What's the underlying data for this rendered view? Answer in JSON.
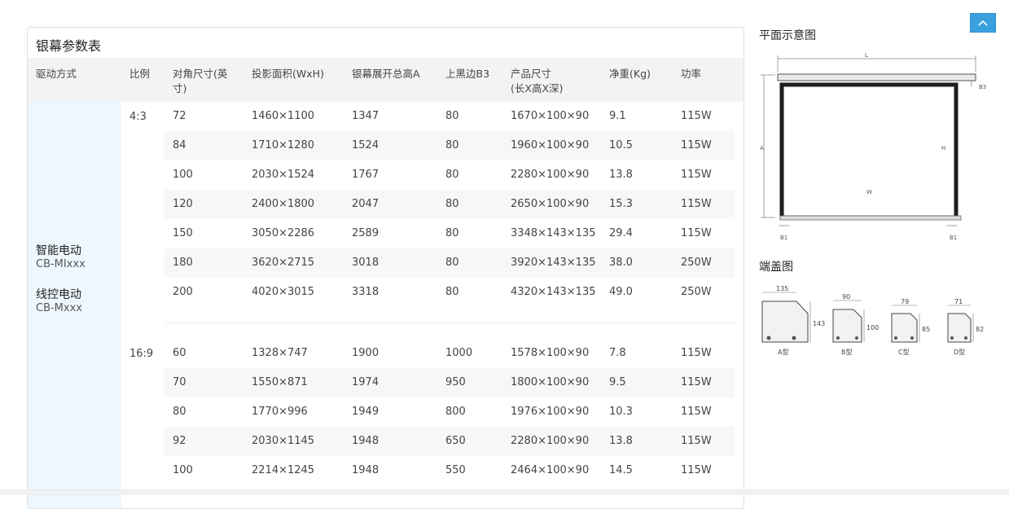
{
  "table": {
    "title": "银幕参数表",
    "headers": [
      "驱动方式",
      "比例",
      "对角尺寸(英寸)",
      "投影面积(WxH)",
      "银幕展开总高A",
      "上黑边B3",
      "产品尺寸",
      "净重(Kg)",
      "功率"
    ],
    "header_product_sub": "(长X高X深)",
    "drive_modes": [
      {
        "name": "智能电动",
        "code": "CB-MIxxx"
      },
      {
        "name": "线控电动",
        "code": "CB-Mxxx"
      }
    ],
    "groups": [
      {
        "ratio": "4:3",
        "rows": [
          [
            "72",
            "1460×1100",
            "1347",
            "80",
            "1670×100×90",
            "9.1",
            "115W"
          ],
          [
            "84",
            "1710×1280",
            "1524",
            "80",
            "1960×100×90",
            "10.5",
            "115W"
          ],
          [
            "100",
            "2030×1524",
            "1767",
            "80",
            "2280×100×90",
            "13.8",
            "115W"
          ],
          [
            "120",
            "2400×1800",
            "2047",
            "80",
            "2650×100×90",
            "15.3",
            "115W"
          ],
          [
            "150",
            "3050×2286",
            "2589",
            "80",
            "3348×143×135",
            "29.4",
            "115W"
          ],
          [
            "180",
            "3620×2715",
            "3018",
            "80",
            "3920×143×135",
            "38.0",
            "250W"
          ],
          [
            "200",
            "4020×3015",
            "3318",
            "80",
            "4320×143×135",
            "49.0",
            "250W"
          ]
        ]
      },
      {
        "ratio": "16:9",
        "rows": [
          [
            "60",
            "1328×747",
            "1900",
            "1000",
            "1578×100×90",
            "7.8",
            "115W"
          ],
          [
            "70",
            "1550×871",
            "1974",
            "950",
            "1800×100×90",
            "9.5",
            "115W"
          ],
          [
            "80",
            "1770×996",
            "1949",
            "800",
            "1976×100×90",
            "10.3",
            "115W"
          ],
          [
            "92",
            "2030×1145",
            "1948",
            "650",
            "2280×100×90",
            "13.8",
            "115W"
          ],
          [
            "100",
            "2214×1245",
            "1948",
            "550",
            "2464×100×90",
            "14.5",
            "115W"
          ]
        ]
      }
    ]
  },
  "plan": {
    "title": "平面示意图",
    "labels": {
      "L": "L",
      "B3": "B3",
      "A": "A",
      "H": "H",
      "W": "W",
      "B1": "B1"
    }
  },
  "endcap": {
    "title": "端盖图",
    "items": [
      {
        "w": "135",
        "h": "143",
        "label": "A型"
      },
      {
        "w": "90",
        "h": "100",
        "label": "B型"
      },
      {
        "w": "79",
        "h": "85",
        "label": "C型"
      },
      {
        "w": "71",
        "h": "82",
        "label": "D型"
      }
    ]
  },
  "colors": {
    "accent": "#3aa0dd",
    "drive_bg": "#eef7fd",
    "header_bg": "#f3f3f3"
  }
}
